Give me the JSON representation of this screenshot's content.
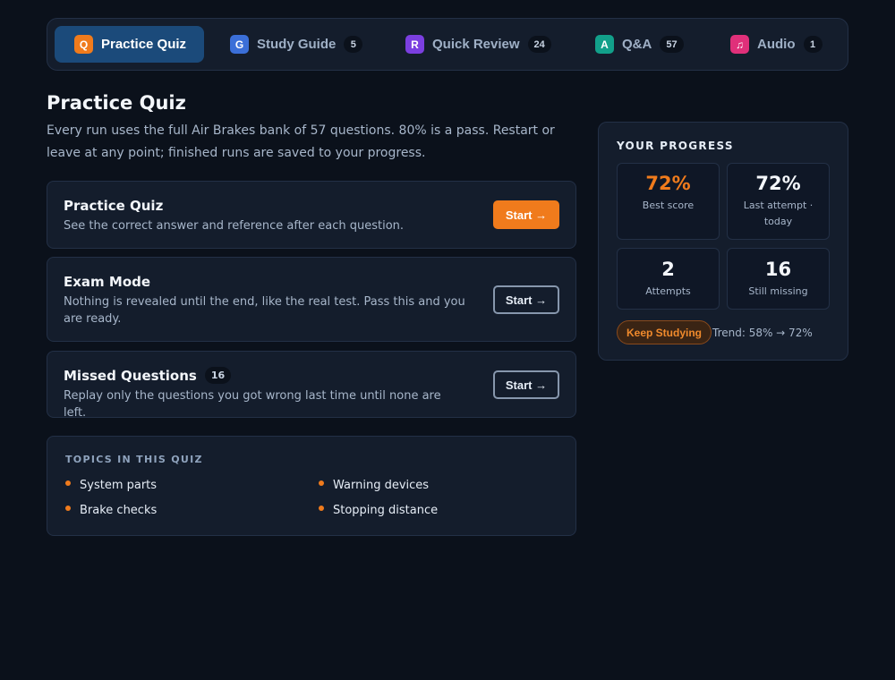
{
  "tabs": [
    {
      "icon": "Q",
      "label": "Practice Quiz",
      "count": null,
      "color": "#f07b1c",
      "active": true
    },
    {
      "icon": "G",
      "label": "Study Guide",
      "count": "5",
      "color": "#3b6fd8",
      "active": false
    },
    {
      "icon": "R",
      "label": "Quick Review",
      "count": "24",
      "color": "#7b3fe0",
      "active": false
    },
    {
      "icon": "A",
      "label": "Q&A",
      "count": "57",
      "color": "#12a08a",
      "active": false
    },
    {
      "icon": "♫",
      "label": "Audio",
      "count": "1",
      "color": "#e0307a",
      "active": false
    }
  ],
  "page": {
    "title": "Practice Quiz",
    "intro": "Every run uses the full Air Brakes bank of 57 questions. 80% is a pass. Restart or leave at any point; finished runs are saved to your progress."
  },
  "modes": [
    {
      "title": "Practice Quiz",
      "description": "See the correct answer and reference after each question.",
      "button": "Start →"
    },
    {
      "title": "Exam Mode",
      "description": "Nothing is revealed until the end, like the real test. Pass this and you are ready.",
      "button": "Start →"
    },
    {
      "title": "Missed Questions",
      "badge": "16",
      "description": "Replay only the questions you got wrong last time until none are left.",
      "button": "Start →"
    }
  ],
  "topics": {
    "heading": "TOPICS IN THIS QUIZ",
    "items": [
      "System parts",
      "Warning devices",
      "Brake checks",
      "Stopping distance"
    ]
  },
  "progress": {
    "heading": "YOUR PROGRESS",
    "stats": [
      {
        "value": "72%",
        "label": "Best score"
      },
      {
        "value": "72%",
        "label": "Last attempt · today"
      },
      {
        "value": "2",
        "label": "Attempts"
      },
      {
        "value": "16",
        "label": "Still missing"
      }
    ],
    "status": "Keep Studying",
    "trend": "Trend: 58% → 72%"
  },
  "colors": {
    "accent": "#f07b1c",
    "active_tab": "#1b4a7a",
    "background": "#0b111b",
    "card": "#141d2c"
  }
}
